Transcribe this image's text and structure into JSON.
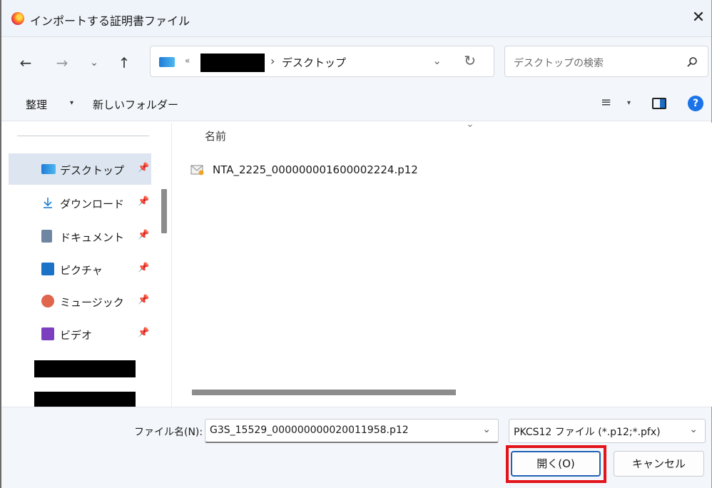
{
  "window": {
    "title": "インポートする証明書ファイル",
    "close_glyph": "✕"
  },
  "nav": {
    "back_glyph": "←",
    "forward_glyph": "→",
    "recent_glyph": "⌄",
    "up_glyph": "↑"
  },
  "address": {
    "chevron": "«",
    "separator": "›",
    "current_folder": "デスクトップ",
    "dropdown_glyph": "⌄",
    "refresh_glyph": "↻"
  },
  "search": {
    "placeholder": "デスクトップの検索"
  },
  "commands": {
    "organize": "整理",
    "organize_caret": "▾",
    "new_folder": "新しいフォルダー",
    "view_glyph": "≡",
    "view_caret": "▾",
    "help_glyph": "?"
  },
  "sidebar": {
    "pin_glyph": "📌",
    "items": [
      {
        "label": "デスクトップ",
        "icon": "desktop-folder-icon"
      },
      {
        "label": "ダウンロード",
        "icon": "download-icon"
      },
      {
        "label": "ドキュメント",
        "icon": "documents-icon"
      },
      {
        "label": "ピクチャ",
        "icon": "pictures-icon"
      },
      {
        "label": "ミュージック",
        "icon": "music-icon"
      },
      {
        "label": "ビデオ",
        "icon": "videos-icon"
      }
    ]
  },
  "content": {
    "column_name": "名前",
    "sort_glyph": "⌄",
    "files": [
      {
        "name": "NTA_2225_000000001600002224.p12",
        "icon": "certificate-file-icon"
      }
    ]
  },
  "footer": {
    "filename_label": "ファイル名(N):",
    "filename_value": "G3S_15529_000000000020011958.p12",
    "filetype_value": "PKCS12 ファイル (*.p12;*.pfx)",
    "dropdown_glyph": "⌄",
    "open_button": "開く(O)",
    "cancel_button": "キャンセル",
    "highlight_color": "#e3141b"
  }
}
